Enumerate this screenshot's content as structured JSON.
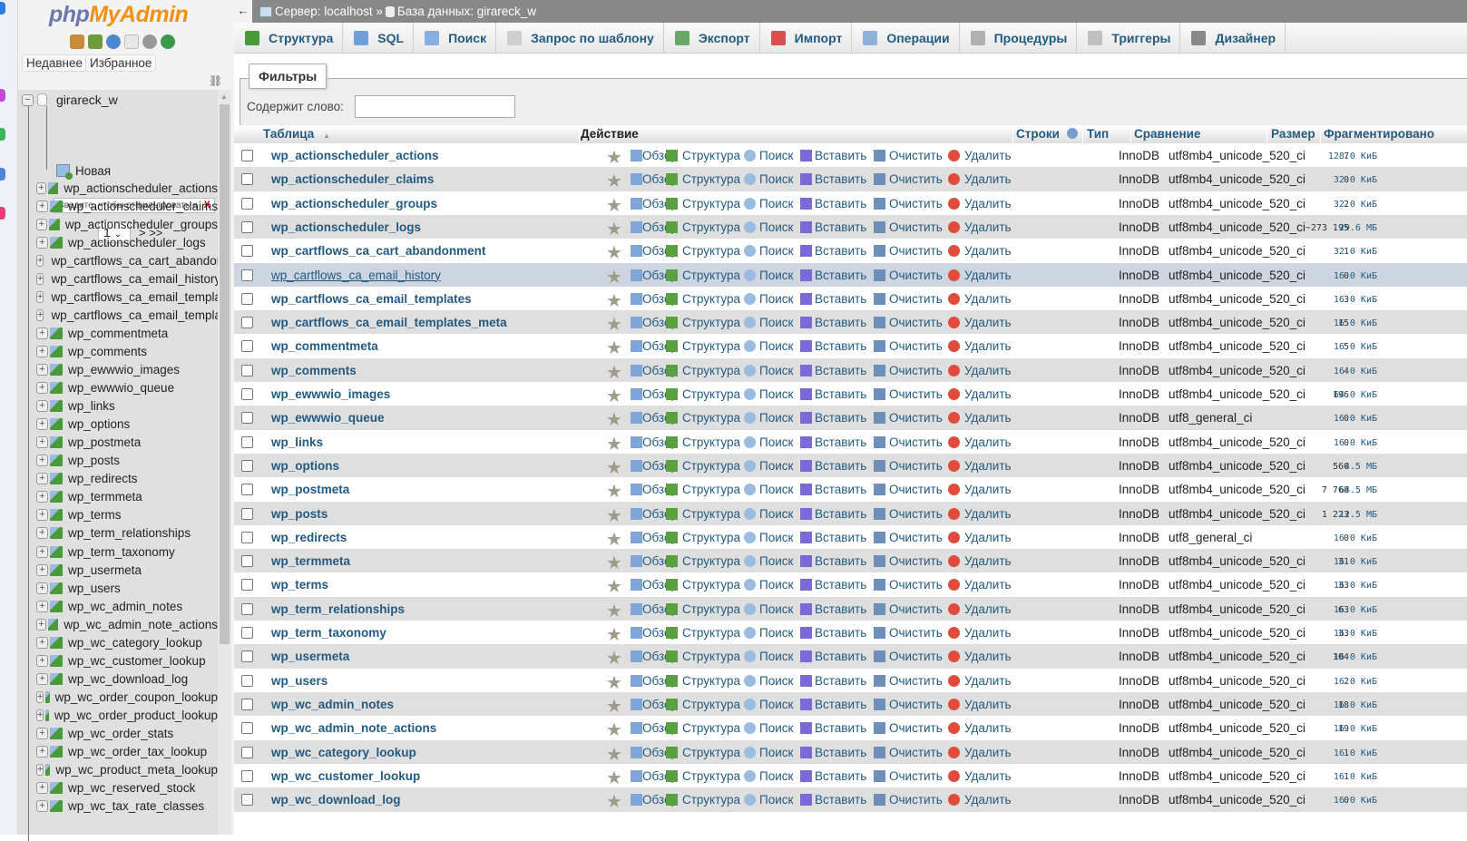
{
  "sidebar": {
    "logo_text": "phpMyAdmin",
    "recent_label": "Недавнее",
    "favorites_label": "Избранное",
    "database": "girareck_w",
    "filter_placeholder": "Введите, чтобы отфильтровать и",
    "filter_clear": "X",
    "page_value": "1",
    "page_next": "> >>",
    "new_label": "Новая",
    "tables": [
      "wp_actionscheduler_actions",
      "wp_actionscheduler_claims",
      "wp_actionscheduler_groups",
      "wp_actionscheduler_logs",
      "wp_cartflows_ca_cart_abandonment",
      "wp_cartflows_ca_email_history",
      "wp_cartflows_ca_email_templates",
      "wp_cartflows_ca_email_templates_meta",
      "wp_commentmeta",
      "wp_comments",
      "wp_ewwwio_images",
      "wp_ewwwio_queue",
      "wp_links",
      "wp_options",
      "wp_postmeta",
      "wp_posts",
      "wp_redirects",
      "wp_termmeta",
      "wp_terms",
      "wp_term_relationships",
      "wp_term_taxonomy",
      "wp_usermeta",
      "wp_users",
      "wp_wc_admin_notes",
      "wp_wc_admin_note_actions",
      "wp_wc_category_lookup",
      "wp_wc_customer_lookup",
      "wp_wc_download_log",
      "wp_wc_order_coupon_lookup",
      "wp_wc_order_product_lookup",
      "wp_wc_order_stats",
      "wp_wc_order_tax_lookup",
      "wp_wc_product_meta_lookup",
      "wp_wc_reserved_stock",
      "wp_wc_tax_rate_classes"
    ]
  },
  "breadcrumb": {
    "back": "←",
    "server": "Сервер: localhost »",
    "database": "База данных: girareck_w"
  },
  "tabs": [
    {
      "label": "Структура",
      "color": "#4a9a3a"
    },
    {
      "label": "SQL",
      "color": "#6f9fd8"
    },
    {
      "label": "Поиск",
      "color": "#8aaee0"
    },
    {
      "label": "Запрос по шаблону",
      "color": "#cfcfcf"
    },
    {
      "label": "Экспорт",
      "color": "#6aa86a"
    },
    {
      "label": "Импорт",
      "color": "#d85050"
    },
    {
      "label": "Операции",
      "color": "#8fb0d8"
    },
    {
      "label": "Процедуры",
      "color": "#b0b0b0"
    },
    {
      "label": "Триггеры",
      "color": "#c0c0c0"
    },
    {
      "label": "Дизайнер",
      "color": "#888888"
    }
  ],
  "filters": {
    "legend": "Фильтры",
    "label": "Содержит слово:",
    "value": ""
  },
  "columns": {
    "table": "Таблица",
    "sort": "▲",
    "action": "Действие",
    "rows": "Строки",
    "type": "Тип",
    "collation": "Сравнение",
    "size": "Размер",
    "overhead": "Фрагментировано"
  },
  "actions": {
    "browse": "Обзор",
    "structure": "Структура",
    "search": "Поиск",
    "insert": "Вставить",
    "empty": "Очистить",
    "drop": "Удалить"
  },
  "rows": [
    {
      "name": "wp_actionscheduler_actions",
      "rows": "7",
      "type": "InnoDB",
      "collation": "utf8mb4_unicode_520_ci",
      "size": "128.0 КиБ"
    },
    {
      "name": "wp_actionscheduler_claims",
      "rows": "0",
      "type": "InnoDB",
      "collation": "utf8mb4_unicode_520_ci",
      "size": "32.0 КиБ"
    },
    {
      "name": "wp_actionscheduler_groups",
      "rows": "2",
      "type": "InnoDB",
      "collation": "utf8mb4_unicode_520_ci",
      "size": "32.0 КиБ"
    },
    {
      "name": "wp_actionscheduler_logs",
      "rows": "~273 195",
      "type": "InnoDB",
      "collation": "utf8mb4_unicode_520_ci",
      "size": "29.6 МБ"
    },
    {
      "name": "wp_cartflows_ca_cart_abandonment",
      "rows": "1",
      "type": "InnoDB",
      "collation": "utf8mb4_unicode_520_ci",
      "size": "32.0 КиБ"
    },
    {
      "name": "wp_cartflows_ca_email_history",
      "rows": "0",
      "type": "InnoDB",
      "collation": "utf8mb4_unicode_520_ci",
      "size": "16.0 КиБ"
    },
    {
      "name": "wp_cartflows_ca_email_templates",
      "rows": "3",
      "type": "InnoDB",
      "collation": "utf8mb4_unicode_520_ci",
      "size": "16.0 КиБ"
    },
    {
      "name": "wp_cartflows_ca_email_templates_meta",
      "rows": "15",
      "type": "InnoDB",
      "collation": "utf8mb4_unicode_520_ci",
      "size": "16.0 КиБ"
    },
    {
      "name": "wp_commentmeta",
      "rows": "5",
      "type": "InnoDB",
      "collation": "utf8mb4_unicode_520_ci",
      "size": "16.0 КиБ"
    },
    {
      "name": "wp_comments",
      "rows": "4",
      "type": "InnoDB",
      "collation": "utf8mb4_unicode_520_ci",
      "size": "16.0 КиБ"
    },
    {
      "name": "wp_ewwwio_images",
      "rows": "196",
      "type": "InnoDB",
      "collation": "utf8mb4_unicode_520_ci",
      "size": "64.0 КиБ"
    },
    {
      "name": "wp_ewwwio_queue",
      "rows": "0",
      "type": "InnoDB",
      "collation": "utf8_general_ci",
      "size": "16.0 КиБ"
    },
    {
      "name": "wp_links",
      "rows": "0",
      "type": "InnoDB",
      "collation": "utf8mb4_unicode_520_ci",
      "size": "16.0 КиБ"
    },
    {
      "name": "wp_options",
      "rows": "560",
      "type": "InnoDB",
      "collation": "utf8mb4_unicode_520_ci",
      "size": "4.5 МБ"
    },
    {
      "name": "wp_postmeta",
      "rows": "7 768",
      "type": "InnoDB",
      "collation": "utf8mb4_unicode_520_ci",
      "size": "64.5 МБ"
    },
    {
      "name": "wp_posts",
      "rows": "1 223",
      "type": "InnoDB",
      "collation": "utf8mb4_unicode_520_ci",
      "size": "12.5 МБ"
    },
    {
      "name": "wp_redirects",
      "rows": "0",
      "type": "InnoDB",
      "collation": "utf8_general_ci",
      "size": "16.0 КиБ"
    },
    {
      "name": "wp_termmeta",
      "rows": "31",
      "type": "InnoDB",
      "collation": "utf8mb4_unicode_520_ci",
      "size": "16.0 КиБ"
    },
    {
      "name": "wp_terms",
      "rows": "33",
      "type": "InnoDB",
      "collation": "utf8mb4_unicode_520_ci",
      "size": "16.0 КиБ"
    },
    {
      "name": "wp_term_relationships",
      "rows": "63",
      "type": "InnoDB",
      "collation": "utf8mb4_unicode_520_ci",
      "size": "16.0 КиБ"
    },
    {
      "name": "wp_term_taxonomy",
      "rows": "33",
      "type": "InnoDB",
      "collation": "utf8mb4_unicode_520_ci",
      "size": "16.0 КиБ"
    },
    {
      "name": "wp_usermeta",
      "rows": "104",
      "type": "InnoDB",
      "collation": "utf8mb4_unicode_520_ci",
      "size": "16.0 КиБ"
    },
    {
      "name": "wp_users",
      "rows": "2",
      "type": "InnoDB",
      "collation": "utf8mb4_unicode_520_ci",
      "size": "16.0 КиБ"
    },
    {
      "name": "wp_wc_admin_notes",
      "rows": "18",
      "type": "InnoDB",
      "collation": "utf8mb4_unicode_520_ci",
      "size": "16.0 КиБ"
    },
    {
      "name": "wp_wc_admin_note_actions",
      "rows": "19",
      "type": "InnoDB",
      "collation": "utf8mb4_unicode_520_ci",
      "size": "16.0 КиБ"
    },
    {
      "name": "wp_wc_category_lookup",
      "rows": "1",
      "type": "InnoDB",
      "collation": "utf8mb4_unicode_520_ci",
      "size": "16.0 КиБ"
    },
    {
      "name": "wp_wc_customer_lookup",
      "rows": "1",
      "type": "InnoDB",
      "collation": "utf8mb4_unicode_520_ci",
      "size": "16.0 КиБ"
    },
    {
      "name": "wp_wc_download_log",
      "rows": "0",
      "type": "InnoDB",
      "collation": "utf8mb4_unicode_520_ci",
      "size": "16.0 КиБ"
    }
  ],
  "highlighted_row": 5
}
